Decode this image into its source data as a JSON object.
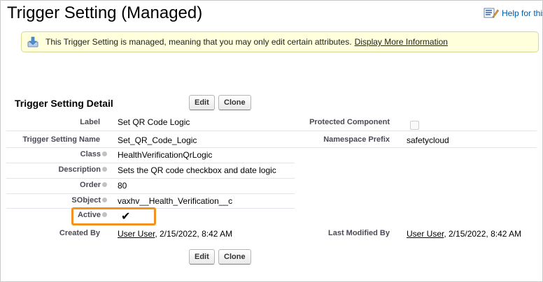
{
  "header": {
    "title": "Trigger Setting (Managed)",
    "help_label": "Help for this"
  },
  "banner": {
    "message": "This Trigger Setting is managed, meaning that you may only edit certain attributes.",
    "link": "Display More Information"
  },
  "detail": {
    "title": "Trigger Setting Detail",
    "edit_label": "Edit",
    "clone_label": "Clone"
  },
  "fields": {
    "label": {
      "label": "Label",
      "value": "Set QR Code Logic"
    },
    "protected": {
      "label": "Protected Component",
      "checked": false
    },
    "name": {
      "label": "Trigger Setting Name",
      "value": "Set_QR_Code_Logic"
    },
    "namespace": {
      "label": "Namespace Prefix",
      "value": "safetycloud"
    },
    "class": {
      "label": "Class",
      "value": "HealthVerificationQrLogic"
    },
    "description": {
      "label": "Description",
      "value": "Sets the QR code checkbox and date logic"
    },
    "order": {
      "label": "Order",
      "value": "80"
    },
    "sobject": {
      "label": "SObject",
      "value": "vaxhv__Health_Verification__c"
    },
    "active": {
      "label": "Active",
      "checked": true,
      "mark": "✔"
    },
    "created_by": {
      "label": "Created By",
      "user": "User User",
      "date": ", 2/15/2022, 8:42 AM"
    },
    "modified_by": {
      "label": "Last Modified By",
      "user": "User User",
      "date": ", 2/15/2022, 8:42 AM"
    }
  },
  "colors": {
    "highlight": "#f29220",
    "banner_bg": "#ffffdc",
    "link": "#015ba7"
  }
}
